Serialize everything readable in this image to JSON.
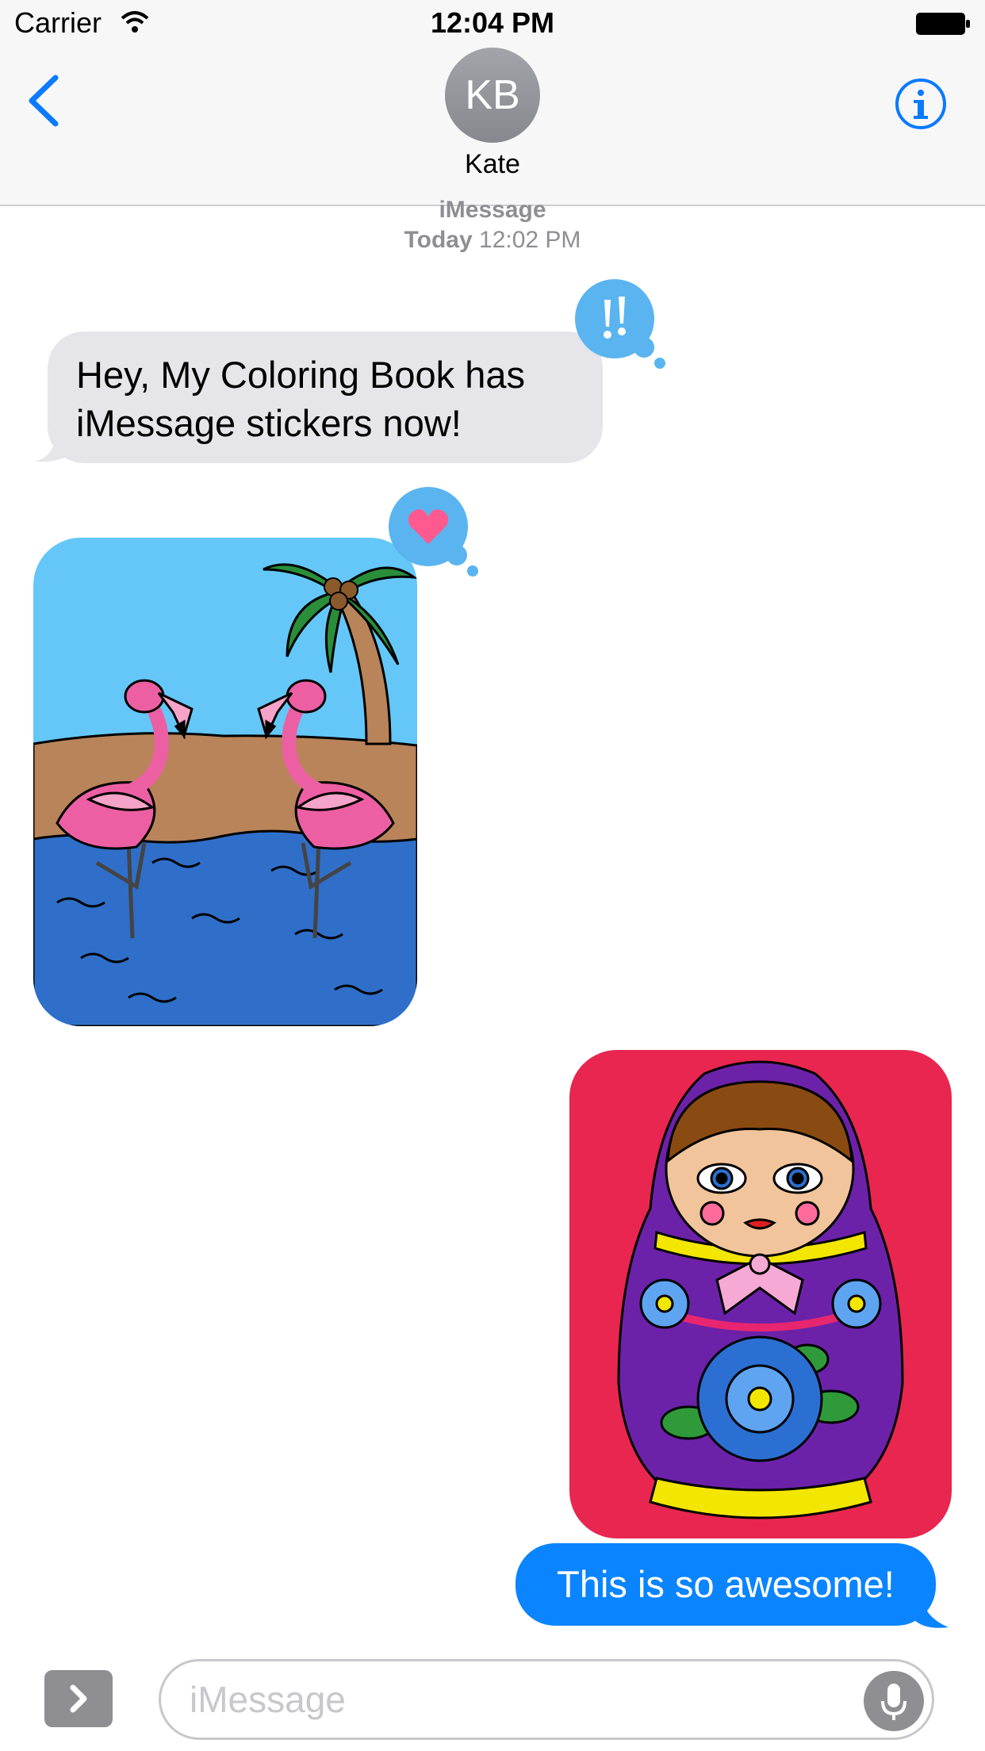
{
  "status_bar": {
    "carrier": "Carrier",
    "time": "12:04 PM"
  },
  "nav": {
    "avatar_initials": "KB",
    "contact_name": "Kate"
  },
  "conversation": {
    "service": "iMessage",
    "day": "Today",
    "time": "12:02 PM",
    "messages": [
      {
        "direction": "incoming",
        "text": "Hey, My Coloring Book has iMessage stickers now!",
        "tapback": "exclamation-icon"
      },
      {
        "direction": "incoming",
        "sticker": "flamingo-beach-sticker",
        "tapback": "heart-icon"
      },
      {
        "direction": "outgoing",
        "sticker": "matryoshka-doll-sticker"
      },
      {
        "direction": "outgoing",
        "text": "This is so awesome!"
      }
    ]
  },
  "composer": {
    "placeholder": "iMessage"
  },
  "colors": {
    "accent": "#0a84ff",
    "incoming_bubble": "#e5e5ea",
    "tapback": "#5ab4f0"
  }
}
